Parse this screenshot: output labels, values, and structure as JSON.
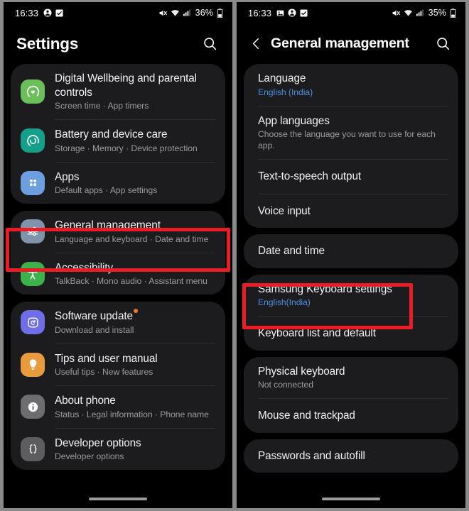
{
  "panels": {
    "left": {
      "status_bar": {
        "time": "16:33",
        "battery_percent": "36%",
        "icons": [
          "person-icon",
          "checkbox-icon",
          "mute-icon",
          "wifi-icon",
          "signal-icon",
          "battery-icon"
        ]
      },
      "header": {
        "title": "Settings",
        "search_icon": "search-icon"
      },
      "groups": [
        {
          "items": [
            {
              "icon": "digital-wellbeing-icon",
              "icon_color": "#6bbf59",
              "title": "Digital Wellbeing and parental controls",
              "subtitle": "Screen time  ·  App timers"
            },
            {
              "icon": "battery-care-icon",
              "icon_color": "#13a08a",
              "title": "Battery and device care",
              "subtitle": "Storage  ·  Memory  ·  Device protection"
            },
            {
              "icon": "apps-icon",
              "icon_color": "#6b9fe0",
              "title": "Apps",
              "subtitle": "Default apps  ·  App settings"
            }
          ]
        },
        {
          "highlighted": true,
          "items": [
            {
              "icon": "sliders-icon",
              "icon_color": "#7f93ab",
              "title": "General management",
              "subtitle": "Language and keyboard  ·  Date and time"
            },
            {
              "icon": "accessibility-icon",
              "icon_color": "#3cb24a",
              "title": "Accessibility",
              "subtitle": "TalkBack  ·  Mono audio  ·  Assistant menu"
            }
          ]
        },
        {
          "items": [
            {
              "icon": "software-update-icon",
              "icon_color": "#6e6ee8",
              "title": "Software update",
              "title_badge": true,
              "subtitle": "Download and install"
            },
            {
              "icon": "lightbulb-icon",
              "icon_color": "#e89a3c",
              "title": "Tips and user manual",
              "subtitle": "Useful tips  ·  New features"
            },
            {
              "icon": "info-icon",
              "icon_color": "#6d6d70",
              "title": "About phone",
              "subtitle": "Status  ·  Legal information  ·  Phone name"
            },
            {
              "icon": "braces-icon",
              "icon_color": "#5d5d60",
              "title": "Developer options",
              "subtitle": "Developer options"
            }
          ]
        }
      ]
    },
    "right": {
      "status_bar": {
        "time": "16:33",
        "battery_percent": "35%",
        "icons": [
          "image-icon",
          "person-icon",
          "checkbox-icon",
          "mute-icon",
          "wifi-icon",
          "signal-icon",
          "battery-icon"
        ]
      },
      "header": {
        "back_icon": "back-arrow-icon",
        "title": "General management",
        "search_icon": "search-icon"
      },
      "groups": [
        {
          "items": [
            {
              "title": "Language",
              "subtitle": "English (India)",
              "subtitle_accent": true
            },
            {
              "title": "App languages",
              "subtitle": "Choose the language you want to use for each app."
            },
            {
              "title": "Text-to-speech output"
            },
            {
              "title": "Voice input"
            }
          ]
        },
        {
          "items": [
            {
              "title": "Date and time"
            }
          ]
        },
        {
          "highlighted": true,
          "items": [
            {
              "title": "Samsung Keyboard settings",
              "subtitle": "English(India)",
              "subtitle_accent": true
            },
            {
              "title": "Keyboard list and default"
            }
          ]
        },
        {
          "items": [
            {
              "title": "Physical keyboard",
              "subtitle": "Not connected"
            },
            {
              "title": "Mouse and trackpad"
            }
          ]
        },
        {
          "items": [
            {
              "title": "Passwords and autofill"
            }
          ]
        }
      ]
    }
  },
  "annotations": {
    "color": "#ec1c24",
    "left_target": "General management",
    "right_target": "Samsung Keyboard settings"
  }
}
